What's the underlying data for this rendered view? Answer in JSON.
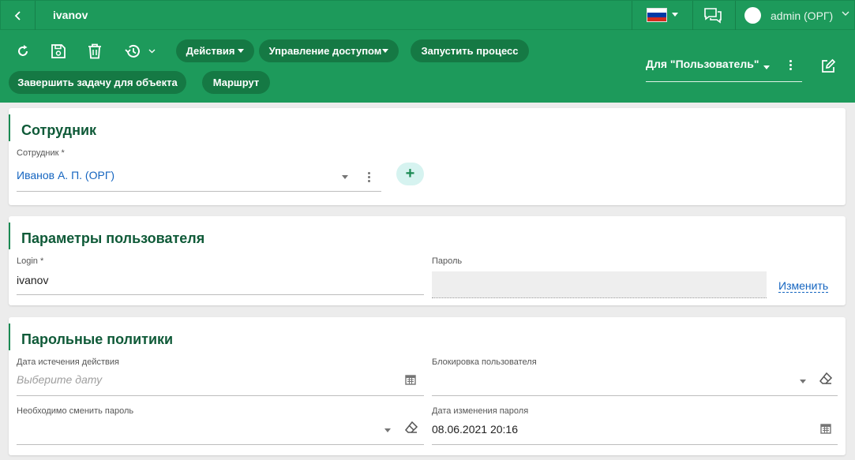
{
  "header": {
    "title": "ivanov",
    "user": "admin (ОРГ)",
    "flag_colors": [
      "#ffffff",
      "#0039a6",
      "#d52b1e"
    ]
  },
  "toolbar": {
    "actions_label": "Действия",
    "access_label": "Управление доступом",
    "start_process_label": "Запустить процесс",
    "finish_task_label": "Завершить задачу для объекта",
    "route_label": "Маршрут",
    "view_label": "Для \"Пользователь\""
  },
  "employee_section": {
    "title": "Сотрудник",
    "field_label": "Сотрудник *",
    "field_value": "Иванов А. П. (ОРГ)",
    "add_label": "+"
  },
  "user_params": {
    "title": "Параметры пользователя",
    "login_label": "Login *",
    "login_value": "ivanov",
    "password_label": "Пароль",
    "change_link": "Изменить"
  },
  "password_policies": {
    "title": "Парольные политики",
    "expiry_label": "Дата истечения действия",
    "expiry_placeholder": "Выберите дату",
    "block_label": "Блокировка пользователя",
    "block_value": "",
    "must_change_label": "Необходимо сменить пароль",
    "must_change_value": "",
    "changed_label": "Дата изменения пароля",
    "changed_value": "08.06.2021 20:16"
  }
}
